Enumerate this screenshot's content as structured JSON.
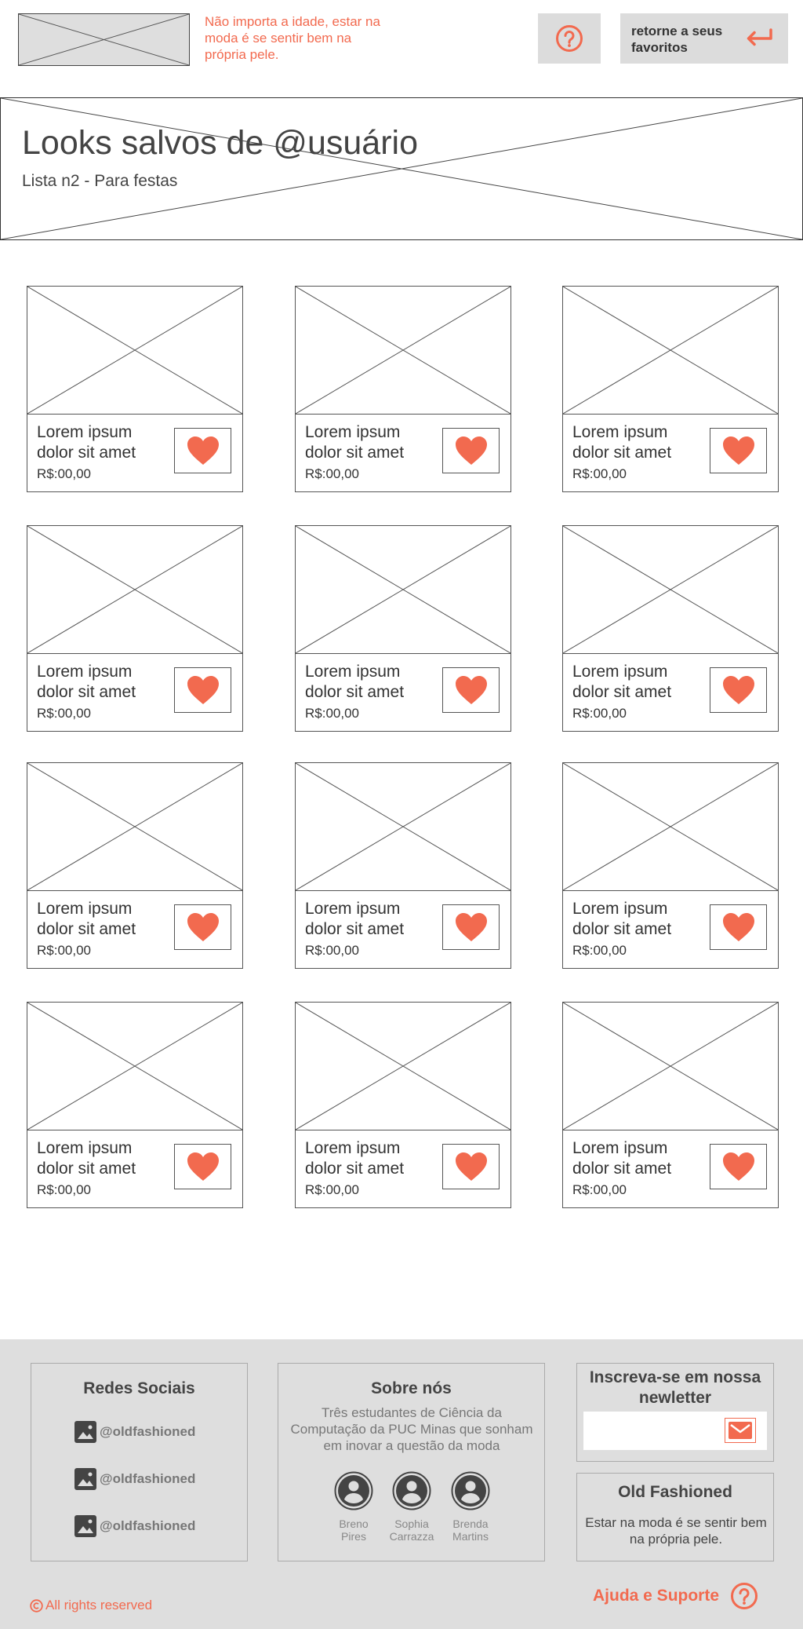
{
  "header": {
    "tagline": "Não importa a idade, estar na moda é se sentir bem na própria pele.",
    "return_label": "retorne a seus favoritos"
  },
  "banner": {
    "title": "Looks salvos de @usuário",
    "subtitle": "Lista n2 - Para festas"
  },
  "products": [
    {
      "name": "Lorem ipsum dolor sit amet",
      "price": "R$:00,00"
    },
    {
      "name": "Lorem ipsum dolor sit amet",
      "price": "R$:00,00"
    },
    {
      "name": "Lorem ipsum dolor sit amet",
      "price": "R$:00,00"
    },
    {
      "name": "Lorem ipsum dolor sit amet",
      "price": "R$:00,00"
    },
    {
      "name": "Lorem ipsum dolor sit amet",
      "price": "R$:00,00"
    },
    {
      "name": "Lorem ipsum dolor sit amet",
      "price": "R$:00,00"
    },
    {
      "name": "Lorem ipsum dolor sit amet",
      "price": "R$:00,00"
    },
    {
      "name": "Lorem ipsum dolor sit amet",
      "price": "R$:00,00"
    },
    {
      "name": "Lorem ipsum dolor sit amet",
      "price": "R$:00,00"
    },
    {
      "name": "Lorem ipsum dolor sit amet",
      "price": "R$:00,00"
    },
    {
      "name": "Lorem ipsum dolor sit amet",
      "price": "R$:00,00"
    },
    {
      "name": "Lorem ipsum dolor sit amet",
      "price": "R$:00,00"
    }
  ],
  "footer": {
    "social": {
      "title": "Redes Sociais",
      "items": [
        "@oldfashioned",
        "@oldfashioned",
        "@oldfashioned"
      ]
    },
    "about": {
      "title": "Sobre nós",
      "text": "Três estudantes de Ciência da Computação da PUC Minas que sonham em inovar a questão da moda",
      "members": [
        {
          "first": "Breno",
          "last": "Pires"
        },
        {
          "first": "Sophia",
          "last": "Carrazza"
        },
        {
          "first": "Brenda",
          "last": "Martins"
        }
      ]
    },
    "newsletter": {
      "title": "Inscreva-se em nossa newletter",
      "placeholder": ""
    },
    "brand": {
      "title": "Old Fashioned",
      "text": "Estar na moda é se sentir bem na própria pele."
    },
    "rights": "All rights reserved",
    "support": "Ajuda e Suporte"
  },
  "colors": {
    "accent": "#f26a4f",
    "footer_bg": "#dedede",
    "button_bg": "#dcdcdc"
  },
  "icons": [
    "question-circle-icon",
    "return-arrow-icon",
    "heart-icon",
    "image-icon",
    "user-avatar-icon",
    "mail-icon",
    "copyright-icon"
  ]
}
